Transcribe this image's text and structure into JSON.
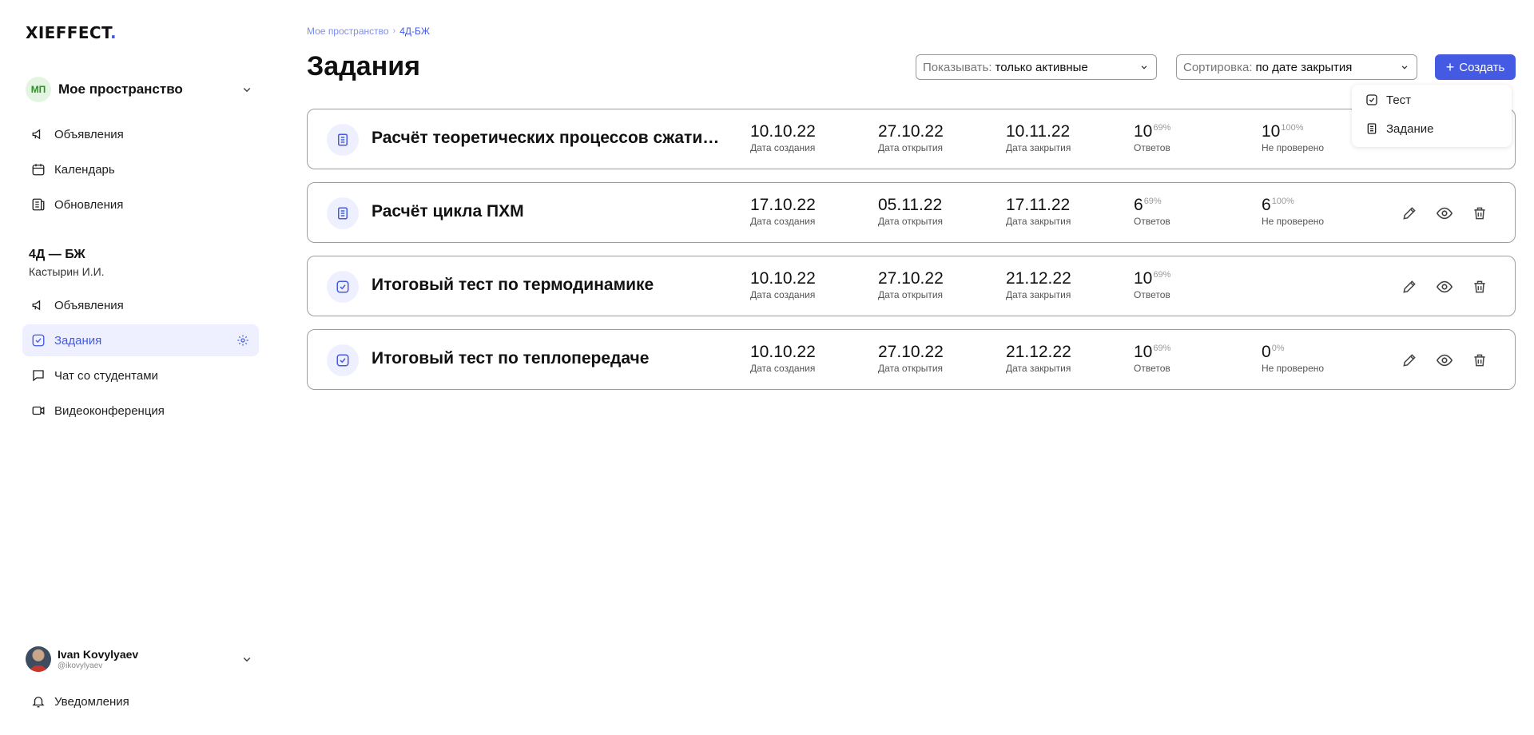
{
  "app": {
    "logo_text": "XIEFFECT",
    "logo_dot": ".",
    "accent": "#445AE3"
  },
  "sidebar": {
    "space": {
      "avatar": "МП",
      "title": "Мое пространство"
    },
    "space_nav": [
      {
        "label": "Объявления",
        "icon": "megaphone-icon"
      },
      {
        "label": "Календарь",
        "icon": "calendar-icon"
      },
      {
        "label": "Обновления",
        "icon": "updates-icon"
      }
    ],
    "course": {
      "title": "4Д — БЖ",
      "teacher": "Кастырин И.И."
    },
    "course_nav": [
      {
        "label": "Объявления",
        "icon": "megaphone-icon"
      },
      {
        "label": "Задания",
        "icon": "task-check-icon",
        "active": true
      },
      {
        "label": "Чат со студентами",
        "icon": "chat-icon"
      },
      {
        "label": "Видеоконференция",
        "icon": "video-icon"
      }
    ],
    "user": {
      "name": "Ivan Kovylyaev",
      "handle": "@ikovylyaev"
    },
    "notifications": "Уведомления"
  },
  "main": {
    "breadcrumb": [
      "Мое пространство",
      "4Д-БЖ"
    ],
    "title": "Задания",
    "filter": {
      "label": "Показывать:",
      "value": "только активные"
    },
    "sort": {
      "label": "Сортировка:",
      "value": "по дате закрытия"
    },
    "create_label": "Создать",
    "create_menu": [
      {
        "label": "Тест",
        "icon": "test-icon"
      },
      {
        "label": "Задание",
        "icon": "document-icon"
      }
    ],
    "captions": {
      "created": "Дата создания",
      "opened": "Дата открытия",
      "closed": "Дата закрытия",
      "answers": "Ответов",
      "unchecked": "Не проверено"
    },
    "tasks": [
      {
        "kind": "document",
        "title": "Расчёт теоретических процессов сжатия...",
        "created": "10.10.22",
        "opened": "27.10.22",
        "closed": "10.11.22",
        "answers": "10",
        "answers_pct": "69%",
        "unchecked": "10",
        "unchecked_pct": "100%"
      },
      {
        "kind": "document",
        "title": "Расчёт цикла ПХМ",
        "created": "17.10.22",
        "opened": "05.11.22",
        "closed": "17.11.22",
        "answers": "6",
        "answers_pct": "69%",
        "unchecked": "6",
        "unchecked_pct": "100%"
      },
      {
        "kind": "test",
        "title": "Итоговый тест по термодинамике",
        "created": "10.10.22",
        "opened": "27.10.22",
        "closed": "21.12.22",
        "answers": "10",
        "answers_pct": "69%"
      },
      {
        "kind": "test",
        "title": "Итоговый тест по теплопередаче",
        "created": "10.10.22",
        "opened": "27.10.22",
        "closed": "21.12.22",
        "answers": "10",
        "answers_pct": "69%",
        "unchecked": "0",
        "unchecked_pct": "0%"
      }
    ]
  }
}
